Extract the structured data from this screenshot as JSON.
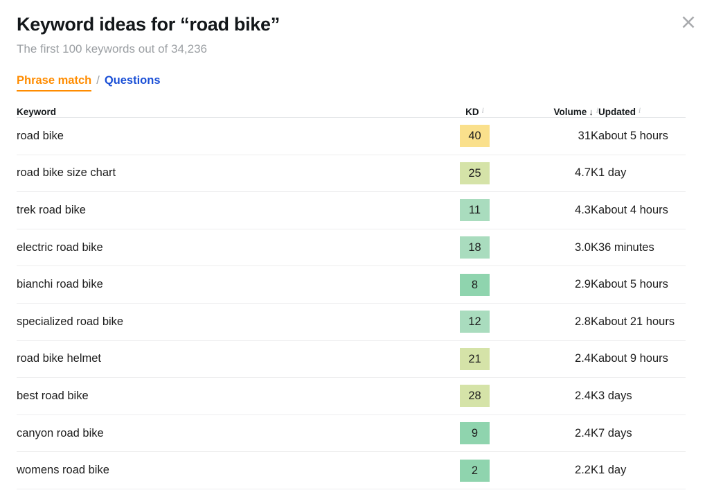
{
  "header": {
    "title": "Keyword ideas for “road bike”",
    "subtitle": "The first 100 keywords out of 34,236",
    "close_icon": "close-icon"
  },
  "tabs": {
    "active_label": "Phrase match",
    "separator": "/",
    "link_label": "Questions"
  },
  "table": {
    "columns": {
      "keyword": "Keyword",
      "kd": "KD",
      "volume": "Volume",
      "updated": "Updated",
      "sort_arrow": "↓",
      "info_icon": "i"
    },
    "rows": [
      {
        "keyword": "road bike",
        "kd": "40",
        "kd_color": "#fae08c",
        "volume": "31K",
        "updated": "about 5 hours"
      },
      {
        "keyword": "road bike size chart",
        "kd": "25",
        "kd_color": "#d5e3a8",
        "volume": "4.7K",
        "updated": "1 day"
      },
      {
        "keyword": "trek road bike",
        "kd": "11",
        "kd_color": "#a9dcbe",
        "volume": "4.3K",
        "updated": "about 4 hours"
      },
      {
        "keyword": "electric road bike",
        "kd": "18",
        "kd_color": "#a9dcbe",
        "volume": "3.0K",
        "updated": "36 minutes"
      },
      {
        "keyword": "bianchi road bike",
        "kd": "8",
        "kd_color": "#8fd4ae",
        "volume": "2.9K",
        "updated": "about 5 hours"
      },
      {
        "keyword": "specialized road bike",
        "kd": "12",
        "kd_color": "#a9dcbe",
        "volume": "2.8K",
        "updated": "about 21 hours"
      },
      {
        "keyword": "road bike helmet",
        "kd": "21",
        "kd_color": "#d5e3a8",
        "volume": "2.4K",
        "updated": "about 9 hours"
      },
      {
        "keyword": "best road bike",
        "kd": "28",
        "kd_color": "#d5e3a8",
        "volume": "2.4K",
        "updated": "3 days"
      },
      {
        "keyword": "canyon road bike",
        "kd": "9",
        "kd_color": "#8fd4ae",
        "volume": "2.4K",
        "updated": "7 days"
      },
      {
        "keyword": "womens road bike",
        "kd": "2",
        "kd_color": "#8fd4ae",
        "volume": "2.2K",
        "updated": "1 day"
      }
    ]
  },
  "colors": {
    "accent_orange": "#ff8c00",
    "link_blue": "#1a4fd6",
    "muted_gray": "#9b9fa3"
  }
}
